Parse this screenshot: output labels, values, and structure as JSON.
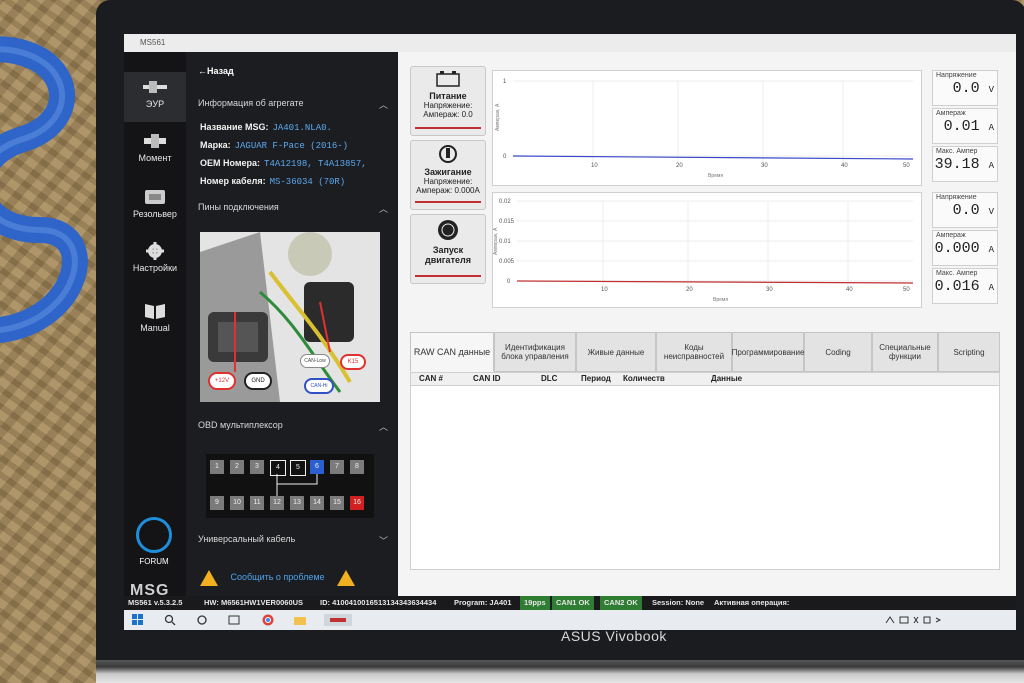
{
  "app": {
    "title": "MS561"
  },
  "nav": {
    "items": [
      {
        "label": "ЭУР",
        "icon": "steering-rack-icon"
      },
      {
        "label": "Момент",
        "icon": "torque-sensor-icon"
      },
      {
        "label": "Резольвер",
        "icon": "resolver-icon"
      },
      {
        "label": "Настройки",
        "icon": "gear-icon"
      },
      {
        "label": "Manual",
        "icon": "book-icon"
      }
    ],
    "forum_label": "FORUM",
    "logo": "MSG"
  },
  "panel": {
    "back_label": "←Назад",
    "unit_info_header": "Информация об агрегате",
    "rows": [
      {
        "label": "Название MSG:",
        "value": "JA401.NLA0."
      },
      {
        "label": "Марка:",
        "value": "JAGUAR F-Pace (2016-)"
      },
      {
        "label": "OEM Номера:",
        "value": "T4A12198, T4A13857,"
      },
      {
        "label": "Номер кабеля:",
        "value": "MS-36034 (70R)"
      }
    ],
    "pins_header": "Пины подключения",
    "pin_labels": [
      "+12V",
      "GND",
      "CAN-Low",
      "CAN-Hi",
      "K15"
    ],
    "obd_header": "OBD мультиплексор",
    "obd_top": [
      "1",
      "2",
      "3",
      "4",
      "5",
      "6",
      "7",
      "8"
    ],
    "obd_bottom": [
      "9",
      "10",
      "11",
      "12",
      "13",
      "14",
      "15",
      "16"
    ],
    "universal_cable": "Универсальный кабель",
    "report_label": "Сообщить о проблеме"
  },
  "power": {
    "buttons": [
      {
        "title": "Питание",
        "line1": "Напряжение:",
        "line2": "Ампераж: 0.0",
        "icon": "battery-icon"
      },
      {
        "title": "Зажигание",
        "line1": "Напряжение:",
        "line2": "Ампераж: 0.000A",
        "icon": "ignition-icon"
      },
      {
        "title": "Запуск двигателя",
        "line1": "",
        "line2": "",
        "icon": "engine-start-icon"
      }
    ]
  },
  "graphs": [
    {
      "ylabel": "Ампераж, А",
      "yticks": [
        "1",
        "0"
      ],
      "xticks": [
        "10",
        "20",
        "30",
        "40",
        "50"
      ],
      "xlabel": "Время"
    },
    {
      "ylabel": "Ампераж, А",
      "yticks": [
        "0.02",
        "0.015",
        "0.01",
        "0.005",
        "0"
      ],
      "xticks": [
        "10",
        "20",
        "30",
        "40",
        "50"
      ],
      "xlabel": "Время"
    }
  ],
  "meters": [
    {
      "label": "Напряжение",
      "value": "0.0",
      "unit": "V"
    },
    {
      "label": "Ампераж",
      "value": "0.01",
      "unit": "A"
    },
    {
      "label": "Макс. Ампер",
      "value": "39.18",
      "unit": "A"
    },
    {
      "label": "Напряжение",
      "value": "0.0",
      "unit": "V"
    },
    {
      "label": "Ампераж",
      "value": "0.000",
      "unit": "A"
    },
    {
      "label": "Макс. Ампер",
      "value": "0.016",
      "unit": "A"
    }
  ],
  "tabs": [
    "RAW CAN данные",
    "Идентификация блока управления",
    "Живые данные",
    "Коды неисправностей",
    "Программирование",
    "Coding",
    "Специальные функции",
    "Scripting"
  ],
  "table": {
    "columns": [
      "CAN #",
      "CAN ID",
      "DLC",
      "Период",
      "Количеств",
      "Данные"
    ]
  },
  "status": {
    "version": "MS561 v.5.3.2.5",
    "hw": "HW: M6561HW1VER0060US",
    "id": "ID: 4100410016513134343634434",
    "program": "Program: JA401",
    "pps": "19pps",
    "can1": "CAN1 OK",
    "can2": "CAN2 OK",
    "session": "Session: None",
    "active_ops": "Активная операция:"
  },
  "laptop": {
    "brand": "ASUS Vivobook"
  }
}
